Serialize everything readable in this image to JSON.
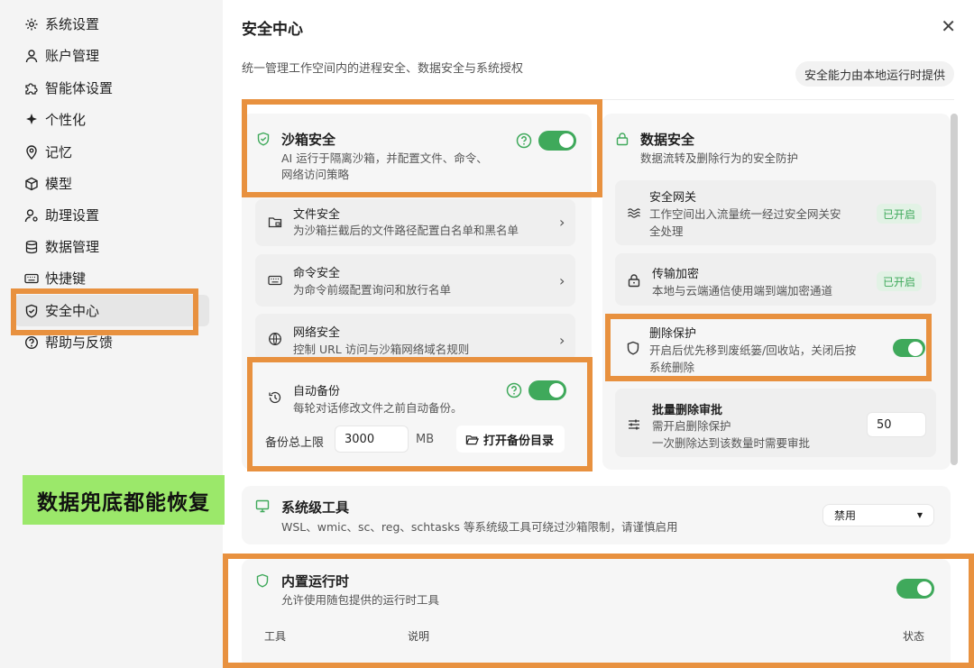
{
  "sidebar": {
    "items": [
      {
        "label": "系统设置",
        "icon": "gear-icon"
      },
      {
        "label": "账户管理",
        "icon": "user-icon"
      },
      {
        "label": "智能体设置",
        "icon": "puzzle-icon"
      },
      {
        "label": "个性化",
        "icon": "sparkle-icon"
      },
      {
        "label": "记忆",
        "icon": "pin-icon"
      },
      {
        "label": "模型",
        "icon": "cube-icon"
      },
      {
        "label": "助理设置",
        "icon": "assistant-icon"
      },
      {
        "label": "数据管理",
        "icon": "database-icon"
      },
      {
        "label": "快捷键",
        "icon": "keyboard-icon"
      },
      {
        "label": "安全中心",
        "icon": "shield-icon"
      },
      {
        "label": "帮助与反馈",
        "icon": "help-icon"
      }
    ],
    "active_index": 9
  },
  "header": {
    "title": "安全中心",
    "subtitle": "统一管理工作空间内的进程安全、数据安全与系统授权",
    "local_badge": "安全能力由本地运行时提供"
  },
  "sandbox": {
    "title": "沙箱安全",
    "desc_line1": "AI 运行于隔离沙箱，并配置文件、命令、",
    "desc_line2": "网络访问策略",
    "enabled": true,
    "rows": [
      {
        "title": "文件安全",
        "desc": "为沙箱拦截后的文件路径配置白名单和黑名单"
      },
      {
        "title": "命令安全",
        "desc": "为命令前缀配置询问和放行名单"
      },
      {
        "title": "网络安全",
        "desc": "控制 URL 访问与沙箱网络域名规则"
      }
    ]
  },
  "backup": {
    "title": "自动备份",
    "desc": "每轮对话修改文件之前自动备份。",
    "limit_label": "备份总上限",
    "limit_value": "3000",
    "unit": "MB",
    "open_dir": "打开备份目录",
    "enabled": true
  },
  "data_security": {
    "title": "数据安全",
    "desc": "数据流转及删除行为的安全防护",
    "gateway": {
      "title": "安全网关",
      "desc_line1": "工作空间出入流量统一经过安全网关安",
      "desc_line2": "全处理",
      "status": "已开启"
    },
    "encryption": {
      "title": "传输加密",
      "desc": "本地与云端通信使用端到端加密通道",
      "status": "已开启"
    },
    "delete_protect": {
      "title": "删除保护",
      "desc_line1": "开启后优先移到废纸篓/回收站，关闭后按",
      "desc_line2": "系统删除",
      "enabled": true
    },
    "batch_delete": {
      "title": "批量删除审批",
      "desc_line1": "需开启删除保护",
      "desc_line2": "一次删除达到该数量时需要审批",
      "value": "50"
    }
  },
  "system_tools": {
    "title": "系统级工具",
    "desc": "WSL、wmic、sc、reg、schtasks 等系统级工具可绕过沙箱限制，请谨慎启用",
    "selected": "禁用"
  },
  "runtime": {
    "title": "内置运行时",
    "desc": "允许使用随包提供的运行时工具",
    "enabled": true,
    "columns": [
      "工具",
      "说明",
      "状态"
    ]
  },
  "callout": {
    "text": "数据兜底都能恢复"
  },
  "colors": {
    "accent_green": "#3fa95b",
    "highlight_orange": "#e8913f",
    "callout_green": "#9be86a"
  }
}
